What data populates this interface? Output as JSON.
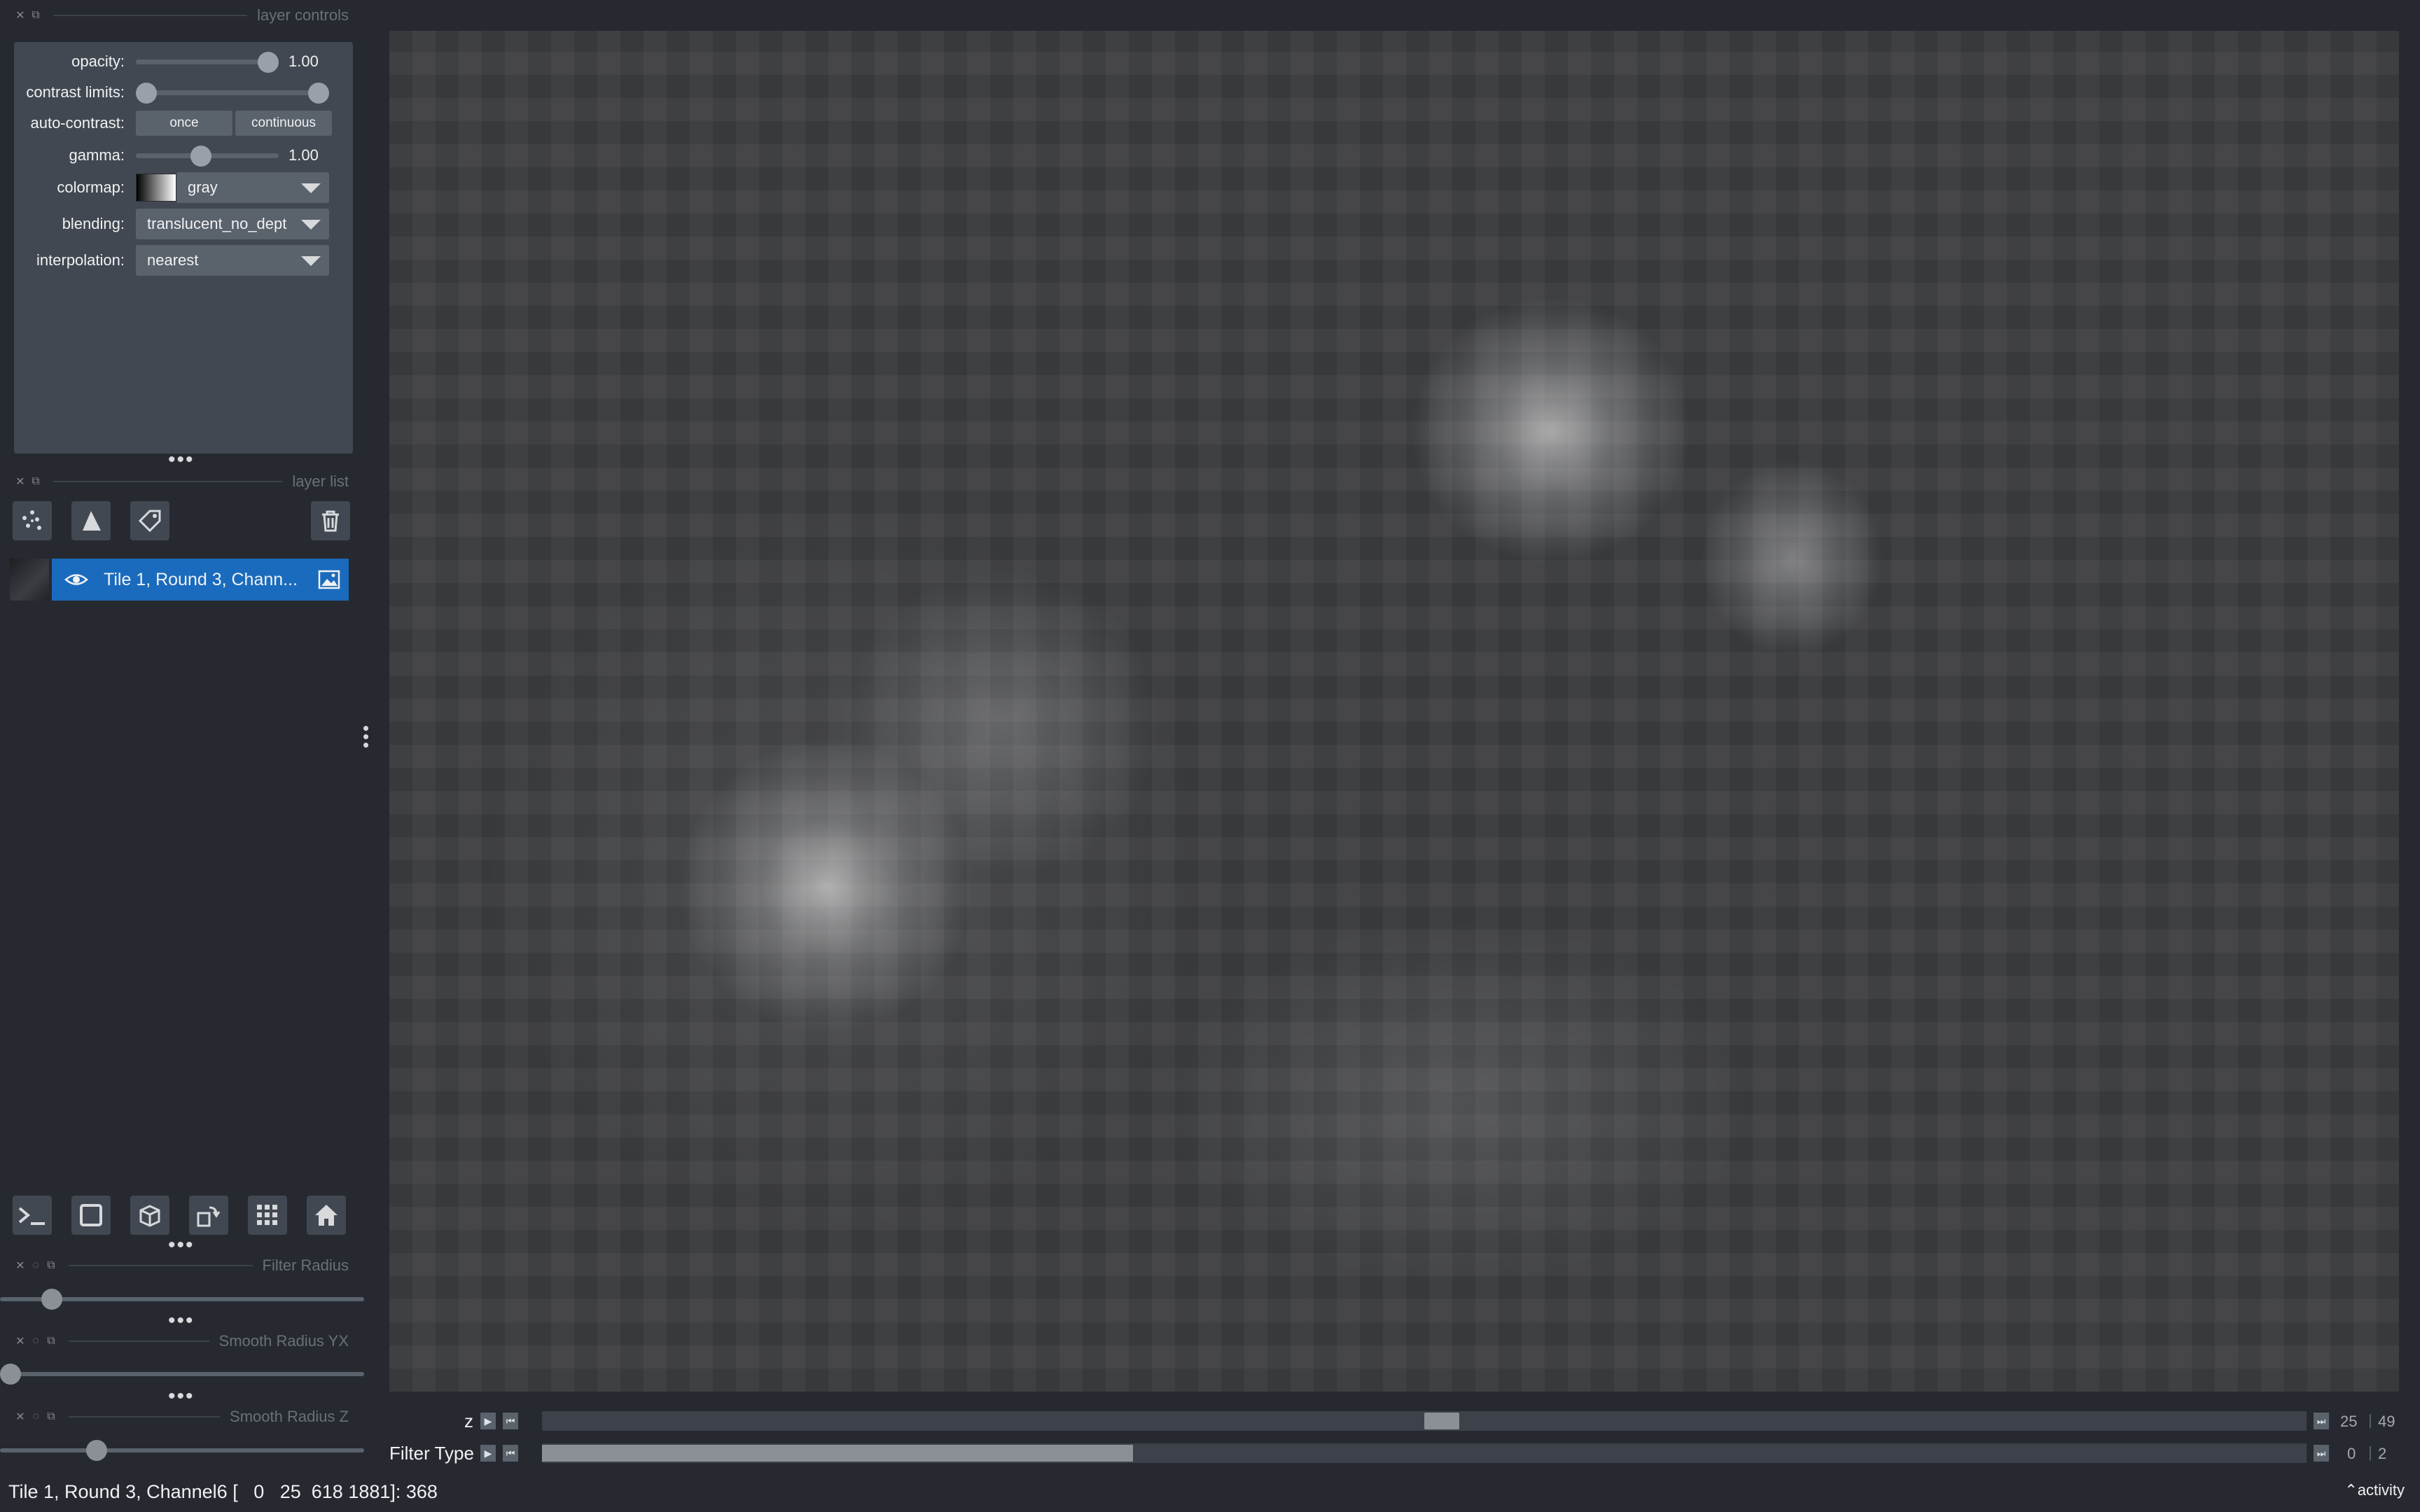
{
  "panels": {
    "layer_controls_title": "layer controls",
    "layer_list_title": "layer list"
  },
  "controls": {
    "opacity": {
      "label": "opacity:",
      "value": "1.00",
      "level": 1.0
    },
    "contrast_limits": {
      "label": "contrast limits:",
      "range": [
        0.0,
        1.0
      ]
    },
    "auto_contrast": {
      "label": "auto-contrast:",
      "once": "once",
      "continuous": "continuous"
    },
    "gamma": {
      "label": "gamma:",
      "value": "1.00",
      "level": 0.45
    },
    "colormap": {
      "label": "colormap:",
      "value": "gray"
    },
    "blending": {
      "label": "blending:",
      "value": "translucent_no_depth"
    },
    "interpolation": {
      "label": "interpolation:",
      "value": "nearest"
    }
  },
  "layer_list": {
    "layers": [
      {
        "name": "Tile 1, Round 3, Chann...",
        "visible": true,
        "type_icon": "image-icon"
      }
    ]
  },
  "viewer_buttons": [
    "console-icon",
    "square-icon",
    "cube-icon",
    "rotate-icon",
    "grid-icon",
    "home-icon"
  ],
  "dims": {
    "z": {
      "label": "z",
      "current": "25",
      "max": "49",
      "position": 0.51
    },
    "filter_type": {
      "label": "Filter Type",
      "current": "0",
      "max": "2",
      "fill": 0.335
    }
  },
  "widgets": {
    "filter_radius": {
      "title": "Filter Radius",
      "level": 0.12
    },
    "smooth_radius_yx": {
      "title": "Smooth Radius YX",
      "level": 0.0
    },
    "smooth_radius_z": {
      "title": "Smooth Radius Z",
      "level": 0.25
    }
  },
  "status": {
    "text": "Tile 1, Round 3, Channel6 [   0   25  618 1881]: 368",
    "activity": "activity"
  },
  "colors": {
    "accent": "#1a6bbd",
    "panel": "#414851",
    "background": "#262930"
  }
}
